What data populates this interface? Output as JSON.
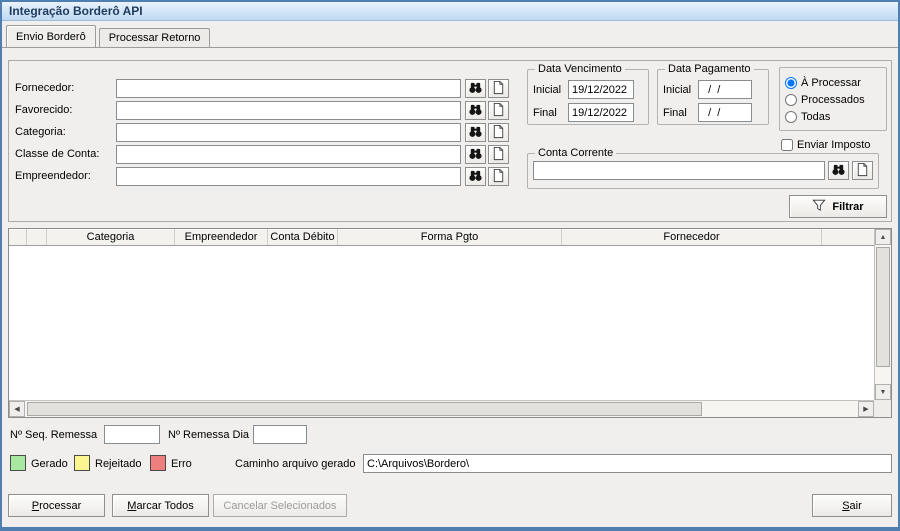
{
  "window": {
    "title": "Integração Borderô API"
  },
  "tabs": {
    "envio": "Envio Borderô",
    "retorno": "Processar Retorno"
  },
  "filters": {
    "fields": [
      {
        "label": "Fornecedor:",
        "value": ""
      },
      {
        "label": "Favorecido:",
        "value": ""
      },
      {
        "label": "Categoria:",
        "value": ""
      },
      {
        "label": "Classe de Conta:",
        "value": ""
      },
      {
        "label": "Empreendedor:",
        "value": ""
      }
    ]
  },
  "data_vencimento": {
    "title": "Data Vencimento",
    "inicial_label": "Inicial",
    "inicial_value": "19/12/2022",
    "final_label": "Final",
    "final_value": "19/12/2022"
  },
  "data_pagamento": {
    "title": "Data Pagamento",
    "inicial_label": "Inicial",
    "inicial_value": "  /  /",
    "final_label": "Final",
    "final_value": "  /  /"
  },
  "status_filter": {
    "options": [
      {
        "label": "À Processar",
        "selected": true
      },
      {
        "label": "Processados",
        "selected": false
      },
      {
        "label": "Todas",
        "selected": false
      }
    ]
  },
  "enviar_imposto": {
    "label": "Enviar Imposto",
    "checked": false
  },
  "conta_corrente": {
    "title": "Conta Corrente",
    "value": ""
  },
  "filtrar": {
    "label": "Filtrar"
  },
  "grid": {
    "columns": [
      "Categoria",
      "Empreendedor",
      "Conta Débito",
      "Forma Pgto",
      "Fornecedor"
    ]
  },
  "remessa": {
    "seq_label": "Nº Seq. Remessa",
    "seq_value": "",
    "dia_label": "Nº Remessa Dia",
    "dia_value": ""
  },
  "legend": {
    "gerado": {
      "label": "Gerado",
      "color": "#A9E8A0"
    },
    "rejeitado": {
      "label": "Rejeitado",
      "color": "#FBF68F"
    },
    "erro": {
      "label": "Erro",
      "color": "#EF7F7F"
    }
  },
  "caminho": {
    "label": "Caminho arquivo gerado",
    "value": "C:\\Arquivos\\Bordero\\"
  },
  "buttons": {
    "processar": "Processar",
    "marcar_todos": "Marcar Todos",
    "cancelar_selecionados": "Cancelar Selecionados",
    "sair": "Sair"
  },
  "colors": {
    "window_border": "#4E7FB0",
    "titlebar_top": "#E9F3FD",
    "titlebar_bottom": "#BFD9F2"
  }
}
